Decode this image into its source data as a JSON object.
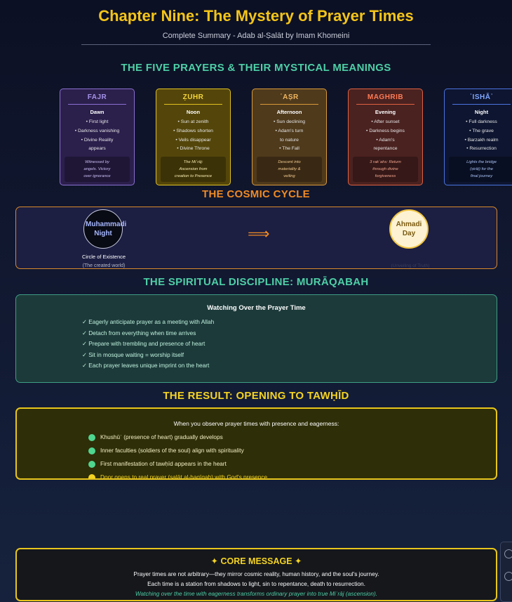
{
  "header": {
    "title": "Chapter Nine: The Mystery of Prayer Times",
    "subtitle": "Complete Summary - Adab al-Ṣalāt by Imam Khomeini"
  },
  "five_prayers": {
    "heading": "THE FIVE PRAYERS & THEIR MYSTICAL MEANINGS",
    "cards": [
      {
        "name": "FAJR",
        "time": "Dawn",
        "points": [
          "• First light",
          "• Darkness vanishing",
          "• Divine Reality",
          "appears"
        ],
        "meaning": [
          "Witnessed by",
          "angels. Victory",
          "over ignorance"
        ],
        "border": "#8b6fd1",
        "bg": "#2b1f4c",
        "accent": "#a592e8",
        "meaning_color": "#c8bdf0"
      },
      {
        "name": "ẒUHR",
        "time": "Noon",
        "points": [
          "• Sun at zenith",
          "• Shadows shorten",
          "• Veils disappear",
          "• Divine Throne"
        ],
        "meaning": [
          "The Miʿrāj:",
          "Ascension from",
          "creation to Presence"
        ],
        "border": "#e0c020",
        "bg": "#54460a",
        "accent": "#f5d637",
        "meaning_color": "#f6ecb0"
      },
      {
        "name": "ʿAṢR",
        "time": "Afternoon",
        "points": [
          "• Sun declining",
          "• Adam's turn",
          "to nature",
          "• The Fall"
        ],
        "meaning": [
          "Descent into",
          "materiality &",
          "veiling"
        ],
        "border": "#d99a3a",
        "bg": "#4f3a1c",
        "accent": "#f0b660",
        "meaning_color": "#f2c98f"
      },
      {
        "name": "MAGHRIB",
        "time": "Evening",
        "points": [
          "• After sunset",
          "• Darkness begins",
          "• Adam's",
          "repentance"
        ],
        "meaning": [
          "3 rakʿahs: Return",
          "through divine",
          "forgiveness"
        ],
        "border": "#e06040",
        "bg": "#4a2220",
        "accent": "#ff7a55",
        "meaning_color": "#f4a58e"
      },
      {
        "name": "ʿISHĀʾ",
        "time": "Night",
        "points": [
          "• Full darkness",
          "• The grave",
          "• Barzakh realm",
          "• Resurrection"
        ],
        "meaning": [
          "Lights the bridge",
          "(ṣirāṭ) for the",
          "final journey"
        ],
        "border": "#4a74e0",
        "bg": "#0d1530",
        "accent": "#7fa6ff",
        "meaning_color": "#a9c1f5"
      }
    ]
  },
  "cosmic_cycle": {
    "heading": "THE COSMIC CYCLE",
    "left_circle": "Muhammadi Night",
    "left_caption": "Circle of Existence",
    "left_subcaption": "(The created world)",
    "arrow": "⟹",
    "right_circle": "Ahmadi Day",
    "right_subcaption": "(Unveiling of Truth)"
  },
  "discipline": {
    "heading": "THE SPIRITUAL DISCIPLINE: MURĀQABAH",
    "box_title": "Watching Over the Prayer Time",
    "items": [
      "✓ Eagerly anticipate prayer as a meeting with Allah",
      "✓ Detach from everything when time arrives",
      "✓ Prepare with trembling and presence of heart",
      "✓ Sit in mosque waiting = worship itself",
      "✓ Each prayer leaves unique imprint on the heart"
    ]
  },
  "result": {
    "heading": "THE RESULT: OPENING TO TAWḤĪD",
    "intro": "When you observe prayer times with presence and eagerness:",
    "items": [
      {
        "text": "Khushūʿ (presence of heart) gradually develops",
        "dot_color": "#4fd68f",
        "text_color": "#f3f0c4"
      },
      {
        "text": "Inner faculties (soldiers of the soul) align with spirituality",
        "dot_color": "#4fd68f",
        "text_color": "#f3f0c4"
      },
      {
        "text": "First manifestation of tawḥīd appears in the heart",
        "dot_color": "#4fd68f",
        "text_color": "#f3f0c4"
      },
      {
        "text": "Door opens to real prayer (ṣalāt al-ḥaqīqah) with God's presence",
        "dot_color": "#f5d422",
        "text_color": "#f5d422"
      }
    ]
  },
  "core": {
    "heading": "✦ CORE MESSAGE ✦",
    "line1": "Prayer times are not arbitrary—they mirror cosmic reality, human history, and the soul's journey.",
    "line2": "Each time is a station from shadows to light, sin to repentance, death to resurrection.",
    "line3": "Watching over the time with eagerness transforms ordinary prayer into true Miʿrāj (ascension)."
  },
  "side_widget": {
    "icons": [
      "zoom-in-icon",
      "zoom-out-icon"
    ]
  },
  "colors": {
    "title": "#f5c518",
    "teal_heading": "#4ecfa6",
    "orange_heading": "#f08a24",
    "gold_heading": "#f5d422"
  }
}
